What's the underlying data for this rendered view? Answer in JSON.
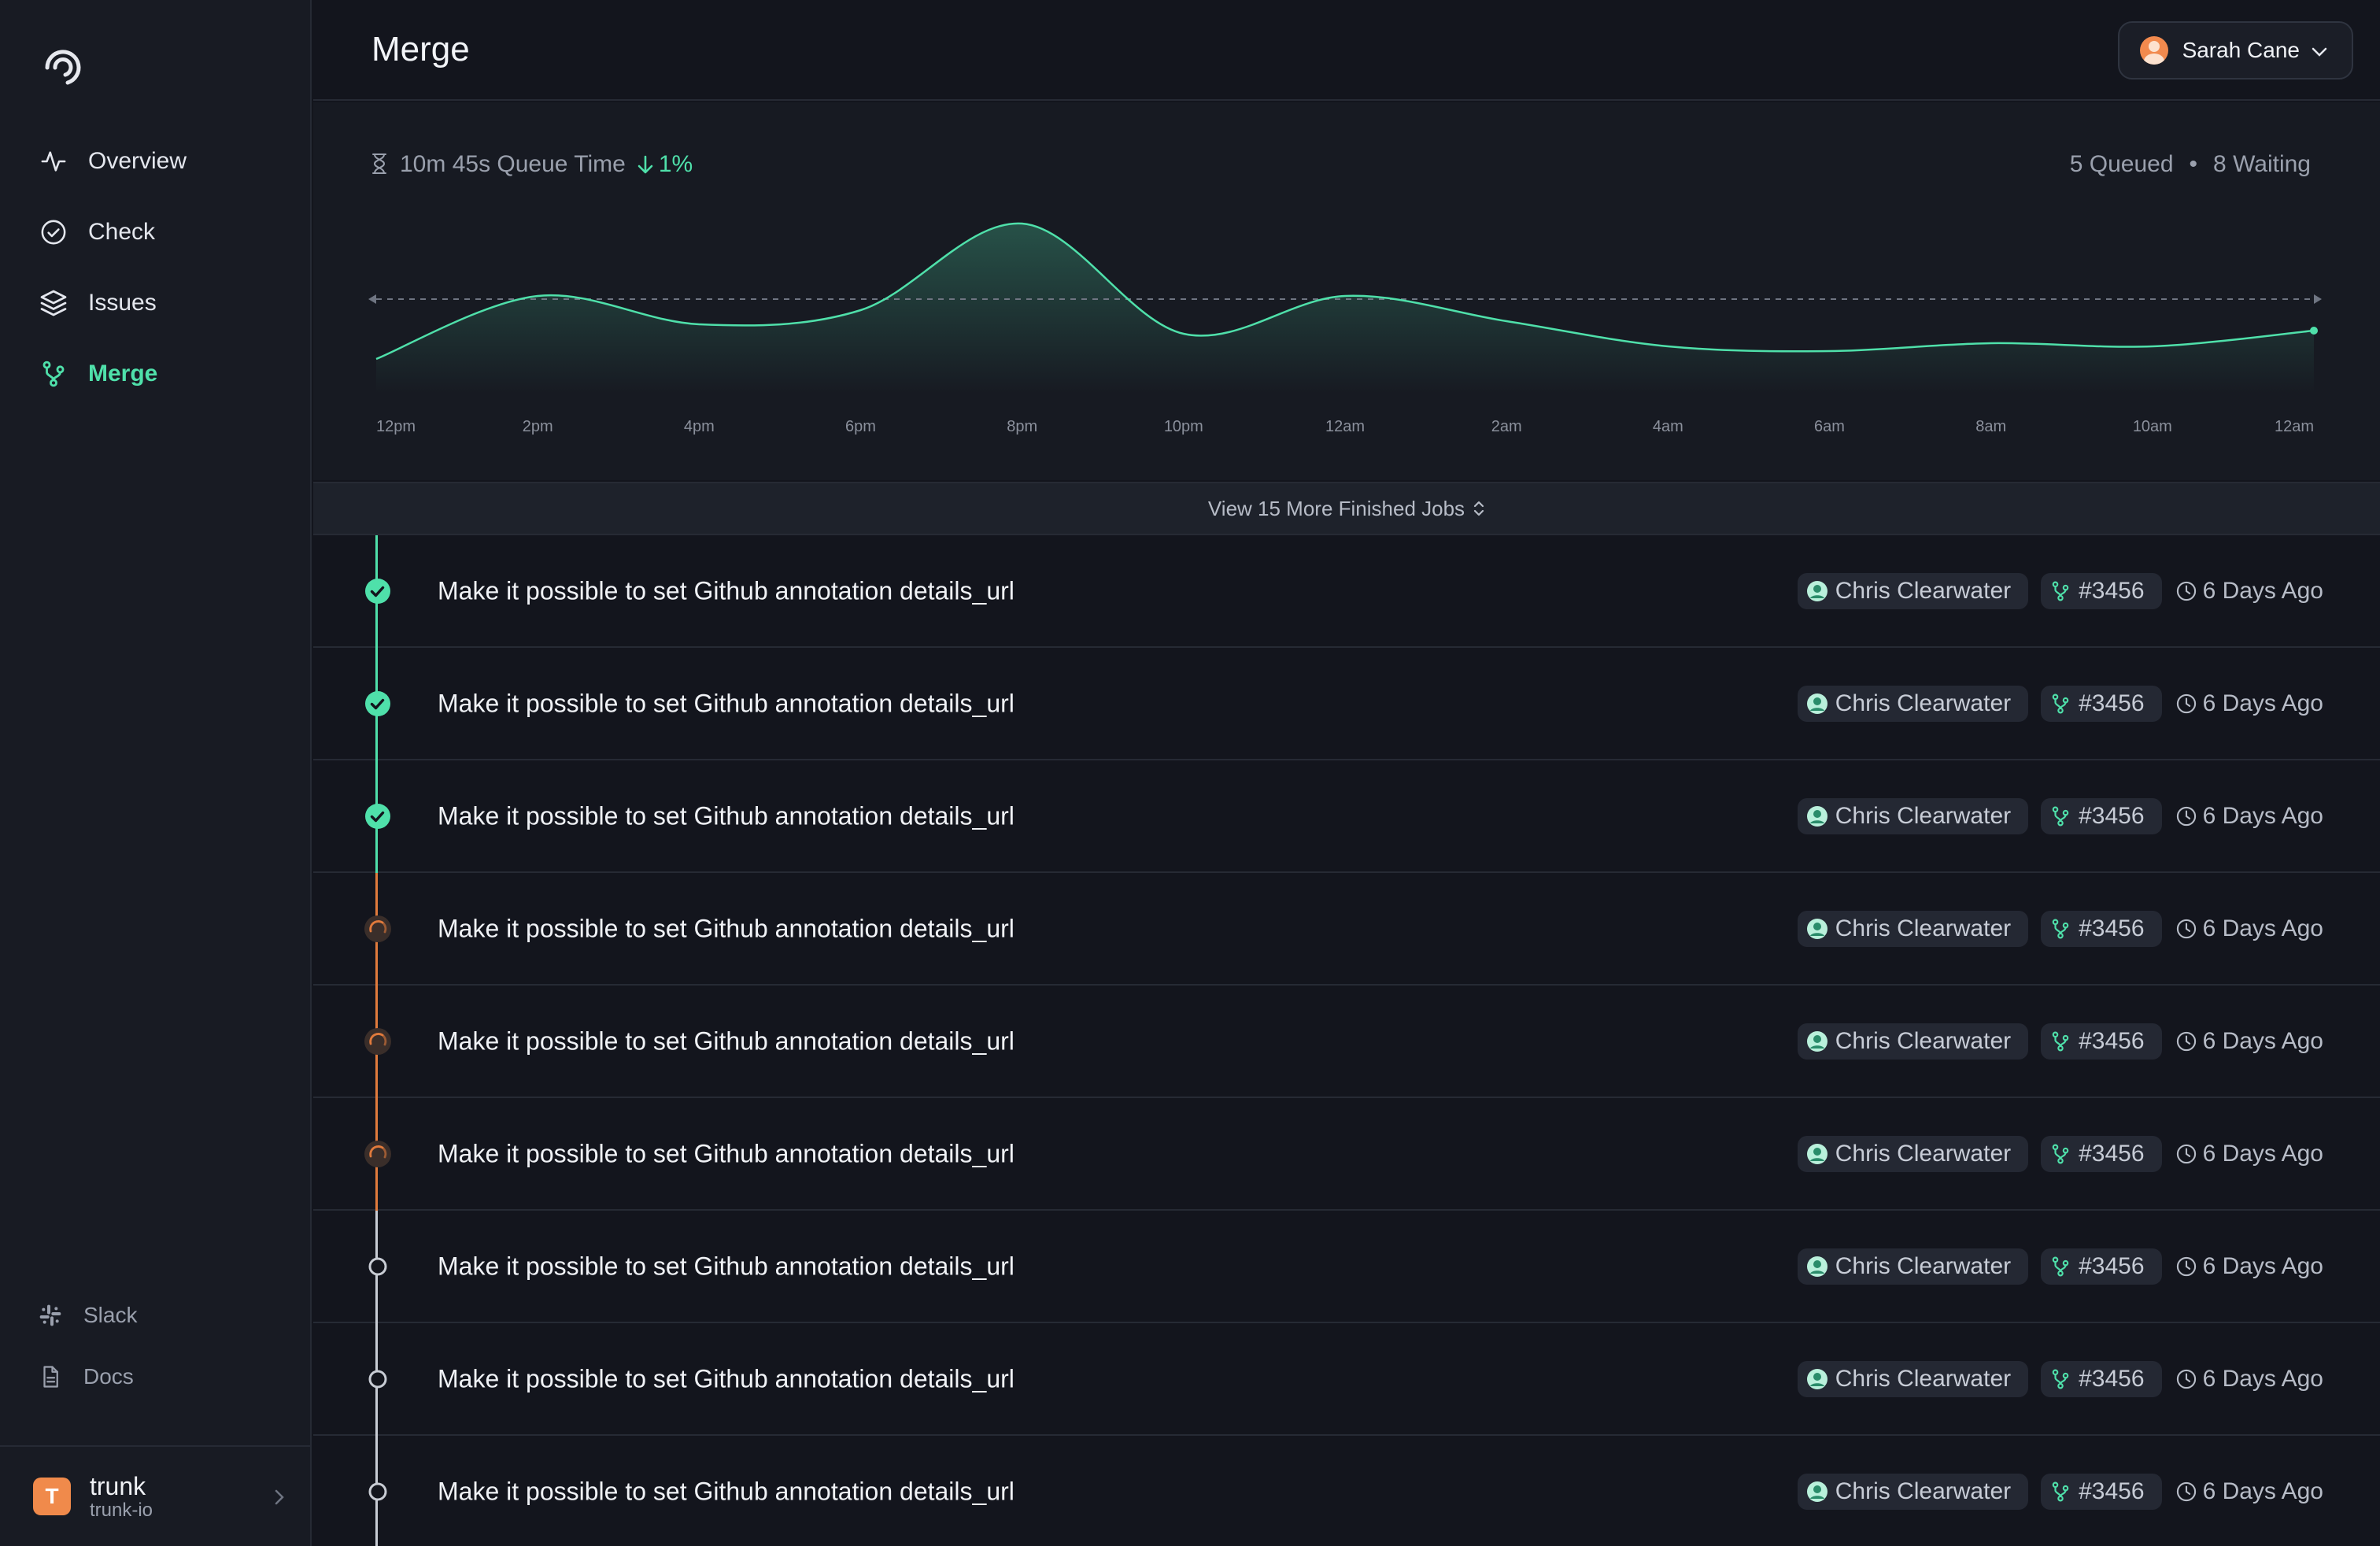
{
  "app": {
    "page_title": "Merge"
  },
  "sidebar": {
    "items": [
      {
        "label": "Overview",
        "icon": "activity-icon",
        "active": false
      },
      {
        "label": "Check",
        "icon": "check-circle-icon",
        "active": false
      },
      {
        "label": "Issues",
        "icon": "layers-icon",
        "active": false
      },
      {
        "label": "Merge",
        "icon": "merge-icon",
        "active": true
      }
    ],
    "bottom_links": [
      {
        "label": "Slack",
        "icon": "slack-icon"
      },
      {
        "label": "Docs",
        "icon": "document-icon"
      }
    ],
    "org": {
      "initial": "T",
      "name": "trunk",
      "slug": "trunk-io"
    }
  },
  "header": {
    "user_name": "Sarah Cane"
  },
  "queue": {
    "time_label": "10m 45s Queue Time",
    "delta": "1%",
    "queued": "5 Queued",
    "separator": "•",
    "waiting": "8 Waiting"
  },
  "colors": {
    "accent": "#4fe0aa",
    "pending": "#e07a3c",
    "queued": "#c8ccd4"
  },
  "chart_data": {
    "type": "area",
    "x_labels": [
      "12pm",
      "2pm",
      "4pm",
      "6pm",
      "8pm",
      "10pm",
      "12am",
      "2am",
      "4am",
      "6am",
      "8am",
      "10am",
      "12am"
    ],
    "series": [
      {
        "values": [
          0.12,
          0.52,
          0.34,
          0.43,
          0.98,
          0.28,
          0.52,
          0.36,
          0.2,
          0.17,
          0.22,
          0.2,
          0.3
        ]
      }
    ],
    "reference_line": 0.5,
    "ylim": [
      0,
      1
    ],
    "grid": false
  },
  "more_jobs_label": "View 15 More Finished Jobs",
  "jobs": [
    {
      "title": "Make it possible to set Github annotation details_url",
      "status": "success",
      "author": "Chris Clearwater",
      "pr": "#3456",
      "age": "6 Days Ago"
    },
    {
      "title": "Make it possible to set Github annotation details_url",
      "status": "success",
      "author": "Chris Clearwater",
      "pr": "#3456",
      "age": "6 Days Ago"
    },
    {
      "title": "Make it possible to set Github annotation details_url",
      "status": "success",
      "author": "Chris Clearwater",
      "pr": "#3456",
      "age": "6 Days Ago"
    },
    {
      "title": "Make it possible to set Github annotation details_url",
      "status": "running",
      "author": "Chris Clearwater",
      "pr": "#3456",
      "age": "6 Days Ago"
    },
    {
      "title": "Make it possible to set Github annotation details_url",
      "status": "running",
      "author": "Chris Clearwater",
      "pr": "#3456",
      "age": "6 Days Ago"
    },
    {
      "title": "Make it possible to set Github annotation details_url",
      "status": "running",
      "author": "Chris Clearwater",
      "pr": "#3456",
      "age": "6 Days Ago"
    },
    {
      "title": "Make it possible to set Github annotation details_url",
      "status": "queued",
      "author": "Chris Clearwater",
      "pr": "#3456",
      "age": "6 Days Ago"
    },
    {
      "title": "Make it possible to set Github annotation details_url",
      "status": "queued",
      "author": "Chris Clearwater",
      "pr": "#3456",
      "age": "6 Days Ago"
    },
    {
      "title": "Make it possible to set Github annotation details_url",
      "status": "queued",
      "author": "Chris Clearwater",
      "pr": "#3456",
      "age": "6 Days Ago"
    }
  ]
}
